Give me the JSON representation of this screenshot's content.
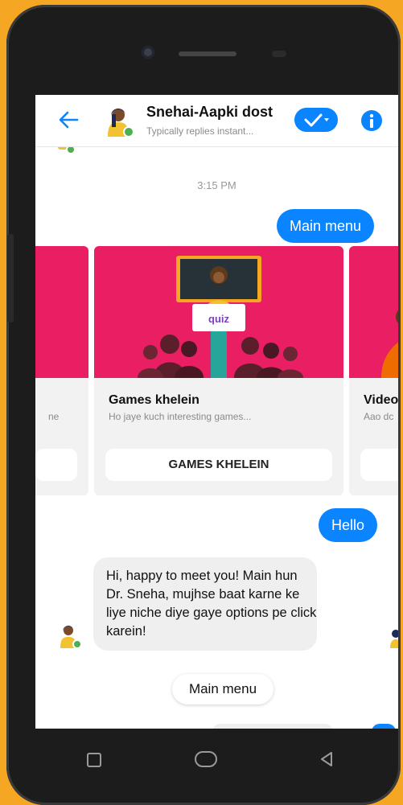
{
  "header": {
    "contact_name": "Snehai-Aapki dost",
    "status": "Typically replies instant..."
  },
  "chat": {
    "timestamp": "3:15 PM",
    "outgoing_main_menu": "Main menu",
    "cards": [
      {
        "title": "",
        "subtitle": "ne",
        "button": ""
      },
      {
        "title": "Games khelein",
        "subtitle": "Ho jaye kuch interesting games...",
        "button": "GAMES KHELEIN",
        "image_sign": "quiz"
      },
      {
        "title": "Video",
        "subtitle": "Aao dc",
        "button": ""
      }
    ],
    "outgoing_hello": "Hello",
    "incoming_message": "Hi, happy to meet you! Main hun Dr. Sneha, mujhse baat karne ke liye niche diye gaye options pe click karein!",
    "quick_reply": "Main menu"
  },
  "colors": {
    "messenger_blue": "#0a84ff",
    "card_pink": "#e91e63",
    "frame_orange": "#f5a623"
  },
  "icons": [
    "back-arrow-icon",
    "check-dropdown-icon",
    "info-icon",
    "recents-icon",
    "home-icon",
    "back-triangle-icon"
  ]
}
